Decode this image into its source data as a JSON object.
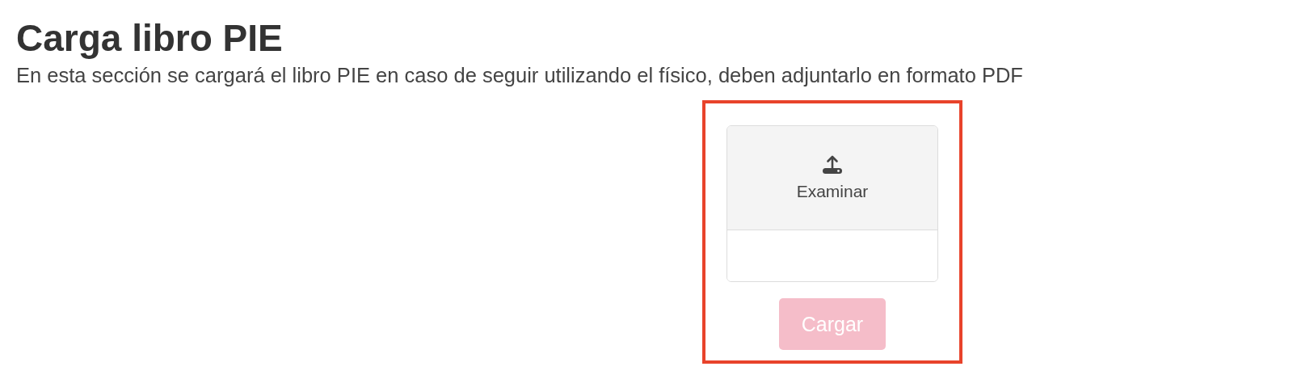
{
  "title": "Carga libro PIE",
  "description": "En esta sección se cargará el libro PIE en caso de seguir utilizando el físico, deben adjuntarlo en formato PDF",
  "upload": {
    "label": "Examinar"
  },
  "submit_button": {
    "label": "Cargar",
    "disabled": true
  }
}
